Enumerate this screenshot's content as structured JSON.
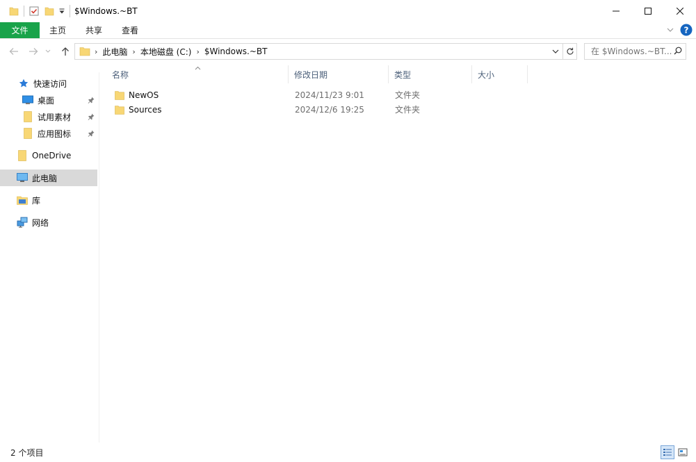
{
  "window": {
    "title": "$Windows.~BT"
  },
  "ribbon": {
    "tabs": [
      "文件",
      "主页",
      "共享",
      "查看"
    ]
  },
  "address": {
    "crumbs": [
      "此电脑",
      "本地磁盘 (C:)",
      "$Windows.~BT"
    ],
    "search_placeholder": "在 $Windows.~BT..."
  },
  "nav": {
    "quick_access": "快速访问",
    "pinned": [
      "桌面",
      "试用素材",
      "应用图标"
    ],
    "onedrive": "OneDrive",
    "this_pc": "此电脑",
    "library": "库",
    "network": "网络"
  },
  "columns": [
    "名称",
    "修改日期",
    "类型",
    "大小"
  ],
  "files": [
    {
      "name": "NewOS",
      "date": "2024/11/23 9:01",
      "type": "文件夹"
    },
    {
      "name": "Sources",
      "date": "2024/12/6 19:25",
      "type": "文件夹"
    }
  ],
  "status": {
    "count": "2 个项目"
  },
  "colors": {
    "file_tab": "#19a34a",
    "folder": "#f8d775",
    "selection": "#d9d9d9",
    "header_text": "#4c607a"
  }
}
